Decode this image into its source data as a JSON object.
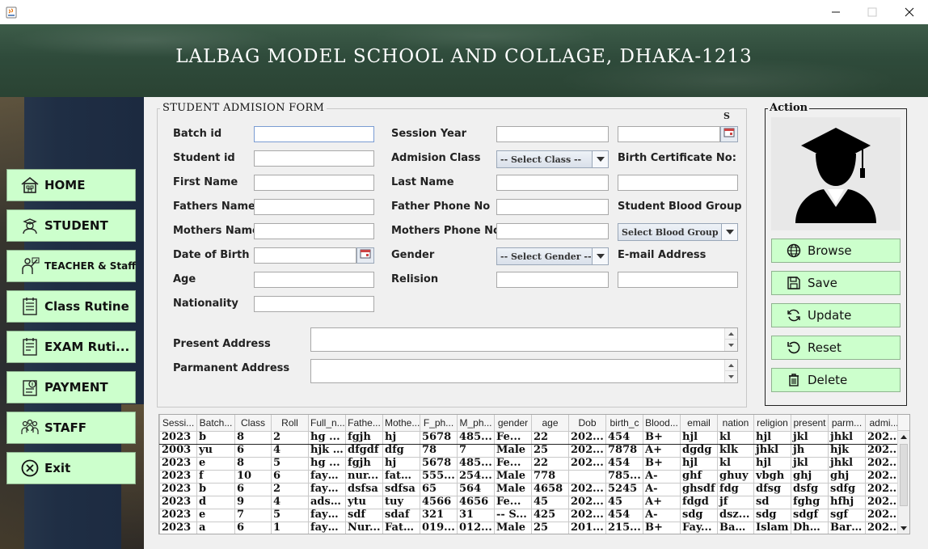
{
  "header": {
    "title": "LALBAG MODEL SCHOOL AND COLLAGE, DHAKA-1213"
  },
  "sidebar": {
    "items": [
      {
        "label": "HOME",
        "icon": "home-icon"
      },
      {
        "label": "STUDENT",
        "icon": "student-icon"
      },
      {
        "label": "TEACHER & Staff",
        "icon": "teacher-icon"
      },
      {
        "label": "Class Rutine",
        "icon": "schedule-icon"
      },
      {
        "label": "EXAM Ruti...",
        "icon": "exam-schedule-icon"
      },
      {
        "label": "PAYMENT",
        "icon": "payment-icon"
      },
      {
        "label": "STAFF",
        "icon": "staff-group-icon"
      },
      {
        "label": "Exit",
        "icon": "exit-icon"
      }
    ]
  },
  "form": {
    "legend": "STUDENT ADMISION FORM",
    "marker": "S",
    "labels": {
      "batch_id": "Batch id",
      "student_id": "Student id",
      "first_name": "First Name",
      "fathers_name": "Fathers Name",
      "mothers_name": "Mothers Name",
      "dob": "Date of Birth",
      "age": "Age",
      "nationality": "Nationality",
      "session_year": "Session Year",
      "admission_class": "Admision Class",
      "last_name": "Last Name",
      "father_phone": "Father Phone No",
      "mother_phone": "Mothers Phone No",
      "gender": "Gender",
      "religion": "Relision",
      "birth_cert": "Birth Certificate No:",
      "blood_group": "Student Blood Group",
      "email": "E-mail Address",
      "present_address": "Present Address",
      "permanent_address": "Parmanent Address"
    },
    "selects": {
      "class": "-- Select Class --",
      "gender": "-- Select Gender --",
      "blood": "Select Blood Group"
    }
  },
  "action": {
    "legend": "Action",
    "buttons": [
      {
        "label": "Browse",
        "icon": "globe-icon"
      },
      {
        "label": "Save",
        "icon": "save-icon"
      },
      {
        "label": "Update",
        "icon": "update-icon"
      },
      {
        "label": "Reset",
        "icon": "reset-icon"
      },
      {
        "label": "Delete",
        "icon": "trash-icon"
      }
    ]
  },
  "table": {
    "columns": [
      "Sessi...",
      "Batch...",
      "Class",
      "Roll",
      "Full_n...",
      "Fathe...",
      "Mothe...",
      "F_ph...",
      "M_ph...",
      "gender",
      "age",
      "Dob",
      "birth_c",
      "Blood...",
      "email",
      "nation",
      "religion",
      "present",
      "parm...",
      "admi..."
    ],
    "rows": [
      [
        "2023",
        "b",
        "8",
        "2",
        "hg ...",
        "fgjh",
        "hj",
        "5678",
        "485...",
        "Fe...",
        "22",
        "202...",
        "454",
        "B+",
        "hjl",
        "kl",
        "hjl",
        "jkl",
        "jhkl",
        "202..."
      ],
      [
        "2003",
        "yu",
        "6",
        "4",
        "hjk ...",
        "dfgdf",
        "dfg",
        "78",
        "7",
        "Male",
        "25",
        "202...",
        "7878",
        "A+",
        "dgdg",
        "klk",
        "jhkl",
        "jh",
        "hjk",
        "202..."
      ],
      [
        "2023",
        "e",
        "8",
        "5",
        "hg ...",
        "fgjh",
        "hj",
        "5678",
        "485...",
        "Fe...",
        "22",
        "202...",
        "454",
        "B+",
        "hjl",
        "kl",
        "hjl",
        "jkl",
        "jhkl",
        "202..."
      ],
      [
        "2023",
        "f",
        "10",
        "6",
        "fays...",
        "nur...",
        "fate...",
        "555...",
        "254...",
        "Male",
        "778",
        "",
        "785...",
        "A-",
        "ghf",
        "ghuy",
        "vbgh",
        "ghj",
        "ghj",
        "202..."
      ],
      [
        "2023",
        "b",
        "6",
        "2",
        "fays...",
        "dsfsa",
        "sdfsa",
        "65",
        "564",
        "Male",
        "4658",
        "202...",
        "5245",
        "A-",
        "ghsdf",
        "fdg",
        "dfsg",
        "dsfg",
        "sdfg",
        "202..."
      ],
      [
        "2023",
        "d",
        "9",
        "4",
        "adsf...",
        "ytu",
        "tuy",
        "4566",
        "4656",
        "Fe...",
        "45",
        "202...",
        "45",
        "A+",
        "fdgd",
        "jf",
        "sd",
        "fghg",
        "hfhj",
        "202..."
      ],
      [
        "2023",
        "e",
        "7",
        "5",
        "fays...",
        "sdf",
        "sdaf",
        "321",
        "31",
        "-- S...",
        "425",
        "202...",
        "454",
        "A-",
        "sdg",
        "dsz...",
        "sdg",
        "sdgf",
        "sgf",
        "202..."
      ],
      [
        "2023",
        "a",
        "6",
        "1",
        "fays...",
        "Nur...",
        "Fate...",
        "019...",
        "012...",
        "Male",
        "25",
        "201...",
        "215...",
        "B+",
        "Fay...",
        "Ban...",
        "Islam",
        "Dha...",
        "Bari...",
        "202..."
      ]
    ]
  }
}
